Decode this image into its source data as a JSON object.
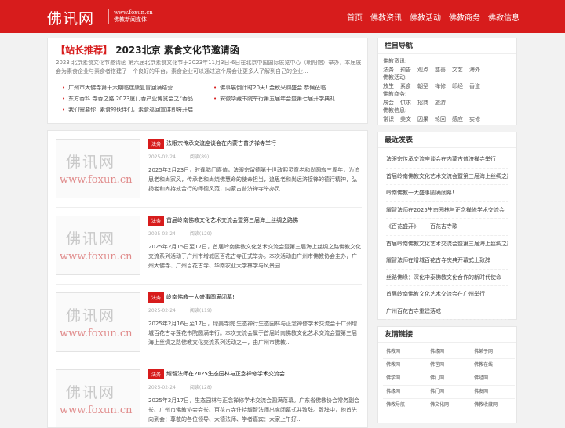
{
  "header": {
    "logo": "佛讯网",
    "logo_sub_1": "www.foxun.cn",
    "logo_sub_2": "佛教新闻媒体!",
    "nav": [
      "首页",
      "佛教资讯",
      "佛教活动",
      "佛教商务",
      "佛教信息"
    ]
  },
  "featured": {
    "tag": "【站长推荐】",
    "title": "2023北京 素食文化节邀请函",
    "desc": "2023 北京素食文化节邀请函 第六届北京素食文化节于2023年11月3日-6日在北京中国国际展览中心（朝阳馆）举办，本届展会为素食企业与素食者搭建了一个良好的平台，素食企业可以通过这个展会让更多人了解到自己的企业...",
    "links": [
      "广州市大佛寺第十六期临症康复冒回满结营",
      "佛事展倒计时20天! 金秋采购盛会 恭候莅临",
      "东方香料 寺香之路 2023厦门香产业博览会之“香品",
      "安徽华藏书院举行第五届年会暨第七届开学典礼",
      "我们需要你! 素食的伙伴们，素食巡回宣讲即将开启"
    ]
  },
  "posts": [
    {
      "category": "法务",
      "title": "法眼宗传承交流座谈会在内蒙古普济禅寺举行",
      "date": "2025-02-24",
      "views": "阅读(89)",
      "excerpt": "2025年2月23日，时逢腊门喜值，法眼宗留德第十世政熙灵意老和尚圆寂三周年，为追思老和尚家风，传承老和尚烧佛慧命的使命担当，追思老和尚远济接锋的德行精神，弘扬老和尚持戒苦行的师德风范，内蒙古普济禅寺举办灵..."
    },
    {
      "category": "法务",
      "title": "首届岭南佛教文化艺术交流会暨第三届海上丝绸之路佛",
      "date": "2025-02-24",
      "views": "阅读(129)",
      "excerpt": "2025年2月15日至17日，首届岭南佛教文化艺术交流会暨第三届海上丝绸之路佛教文化交流系列活动于广州市增城区百花古寺正式举办。本次活动由广州市佛教协会主办，广州大佛寺、广州百花古寺、华南农业大学林学与风景园..."
    },
    {
      "category": "法务",
      "title": "岭南佛教一大盛事圆满闭幕!",
      "date": "2025-02-24",
      "views": "阅读(119)",
      "excerpt": "2025年2月16日至17日，绿美寺院 生态禅行生态园林与正念禅修学术交流会于广州增城百花古寺莲花书院圆满举行。本次交流会属于首届岭南佛教文化艺术交流会暨第三届海上丝绸之路佛教文化交流系列活动之一，由广州市佛教..."
    },
    {
      "category": "法务",
      "title": "耀智法师在2025生态园林与正念禅修学术交流会",
      "date": "2025-02-24",
      "views": "阅读(128)",
      "excerpt": "2025年2月17日，生态园林与正念禅修学术交流会圆满落幕。广东省佛教协会常务副会长、广州市佛教协会会长、百花古寺住持耀智法师出席闭幕式并致辞。致辞中，他首先向到会：尊敬的各位领导、大德法师、学者嘉宾：大家上午好..."
    }
  ],
  "sidebar": {
    "column_nav": {
      "title": "栏目导航",
      "groups": [
        {
          "label": "佛教资讯:",
          "items": [
            "法务",
            "预告",
            "观点",
            "慈善",
            "文艺",
            "海外"
          ]
        },
        {
          "label": "佛教活动:",
          "items": [
            "放生",
            "素食",
            "朝圣",
            "禅修",
            "印经",
            "香道"
          ]
        },
        {
          "label": "佛教商务:",
          "items": [
            "展会",
            "供求",
            "招商",
            "旅游"
          ]
        },
        {
          "label": "佛教信息:",
          "items": [
            "常识",
            "美文",
            "因果",
            "轮回",
            "感应",
            "实修"
          ]
        }
      ]
    },
    "latest": {
      "title": "最近发表",
      "items": [
        "法眼宗传承交流座谈会在内蒙古普济禅寺举行",
        "首届岭南佛教文化艺术交流会暨第三届海上丝绸之路佛",
        "岭南佛教一大盛事圆满闭幕!",
        "耀智法师在2025生态园林与正念禅修学术交流会",
        "《百花盛开》——百花古寺歌",
        "首届岭南佛教文化艺术交流会暨第三届海上丝绸之路佛",
        "耀智法师在增城百花古寺庆典开幕式上致辞",
        "丝路佛缘：深化中泰佛教文化合作的新时代使命",
        "首届岭南佛教文化艺术交流会在广州举行",
        "广州百花古寺重建落成"
      ]
    },
    "friends": {
      "title": "友情链接",
      "items": [
        "佛教网",
        "佛缘网",
        "佛弟子网",
        "佛教网",
        "佛艺网",
        "佛教在线",
        "佛学网",
        "佛门网",
        "佛经网",
        "佛缘网",
        "佛门网",
        "佛友网",
        "佛教导航",
        "佛文化网",
        "佛教收藏网"
      ]
    }
  }
}
